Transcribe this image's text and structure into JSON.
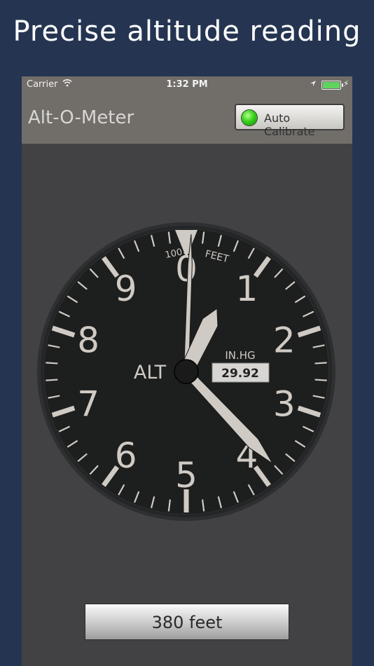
{
  "headline": "Precise altitude reading",
  "status_bar": {
    "carrier": "Carrier",
    "time": "1:32 PM",
    "wifi_icon": "wifi-icon",
    "location_icon": "location-arrow-icon",
    "battery_icon": "battery-charging-icon"
  },
  "nav": {
    "title": "Alt-O-Meter",
    "calibrate_label": "Auto Calibrate",
    "calibrate_led": "on"
  },
  "gauge": {
    "numerals": [
      "0",
      "1",
      "2",
      "3",
      "4",
      "5",
      "6",
      "7",
      "8",
      "9"
    ],
    "center_label": "ALT",
    "scale_label_left": "100",
    "scale_label_right": "FEET",
    "pressure_unit": "IN.HG",
    "pressure_value": "29.92",
    "reading_feet": 380,
    "colors": {
      "bezel": "#2e2f30",
      "face": "#1d1e1e",
      "markings": "#cfcac3"
    }
  },
  "readout": {
    "text": "380 feet"
  }
}
